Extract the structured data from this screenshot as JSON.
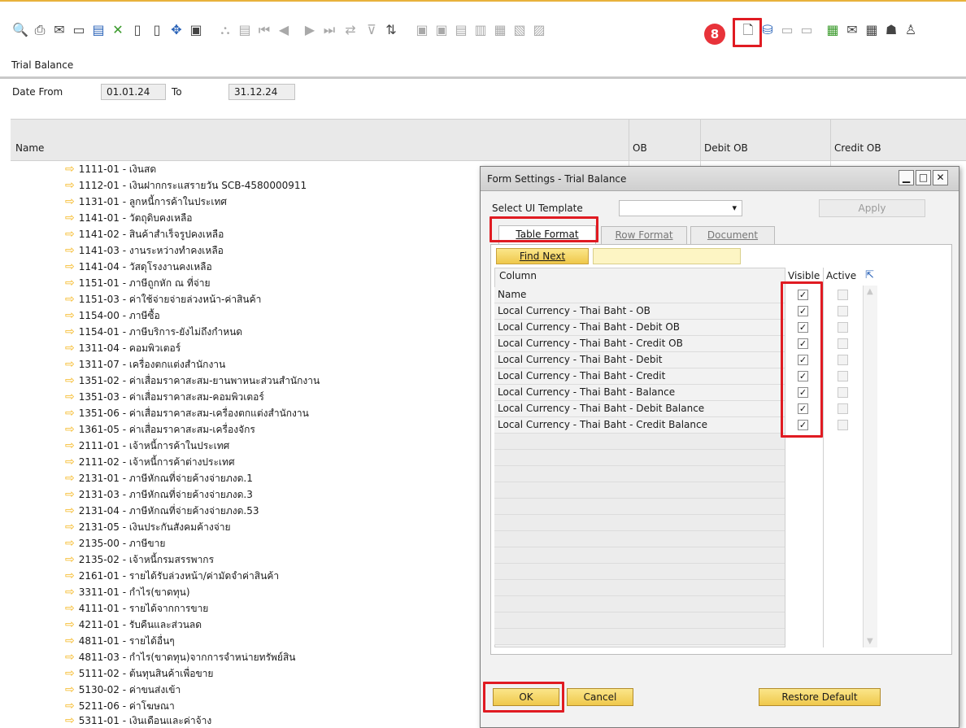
{
  "toolbar": {
    "badge": "8",
    "icons": [
      "print-preview-icon",
      "print-icon",
      "email-icon",
      "export-icon",
      "save-icon",
      "excel-icon",
      "word-icon",
      "pdf-icon",
      "refresh-icon",
      "form-lock-icon",
      "find-icon",
      "drill-icon",
      "first-record-icon",
      "previous-record-icon",
      "next-record-icon",
      "last-record-icon",
      "swap-icon",
      "filter-icon",
      "sort-icon",
      "copy-from-icon",
      "copy-to-icon",
      "base-document-icon",
      "target-document-icon",
      "gross-profit-icon",
      "journal-icon",
      "report-icon",
      "form-settings-icon",
      "query-settings-icon",
      "messages-icon",
      "alerts-icon",
      "calendar-icon",
      "close-mail-icon",
      "calculator-icon",
      "tree-icon",
      "user-icon"
    ]
  },
  "form": {
    "title": "Trial Balance",
    "date_from_label": "Date From",
    "date_from": "01.01.24",
    "to_label": "To",
    "date_to": "31.12.24"
  },
  "grid": {
    "headers": {
      "name": "Name",
      "ob": "OB",
      "debit_ob": "Debit OB",
      "credit_ob": "Credit OB"
    },
    "accounts": [
      "1111-01 - เงินสด",
      "1112-01 - เงินฝากกระแสรายวัน SCB-4580000911",
      "1131-01 - ลูกหนี้การค้าในประเทศ",
      "1141-01 - วัตถุดิบคงเหลือ",
      "1141-02 - สินค้าสำเร็จรูปคงเหลือ",
      "1141-03 - งานระหว่างทำคงเหลือ",
      "1141-04 - วัสดุโรงงานคงเหลือ",
      "1151-01 - ภาษีถูกหัก ณ ที่จ่าย",
      "1151-03 - ค่าใช้จ่ายจ่ายล่วงหน้า-ค่าสินค้า",
      "1154-00 - ภาษีซื้อ",
      "1154-01 - ภาษีบริการ-ยังไม่ถึงกำหนด",
      "1311-04 - คอมพิวเตอร์",
      "1311-07 - เครื่องตกแต่งสำนักงาน",
      "1351-02 - ค่าเสื่อมราคาสะสม-ยานพาหนะส่วนสำนักงาน",
      "1351-03 - ค่าเสื่อมราคาสะสม-คอมพิวเตอร์",
      "1351-06 - ค่าเสื่อมราคาสะสม-เครื่องตกแต่งสำนักงาน",
      "1361-05 - ค่าเสื่อมราคาสะสม-เครื่องจักร",
      "2111-01 - เจ้าหนี้การค้าในประเทศ",
      "2111-02 - เจ้าหนี้การค้าต่างประเทศ",
      "2131-01 - ภาษีหักณที่จ่ายค้างจ่ายภงด.1",
      "2131-03 - ภาษีหักณที่จ่ายค้างจ่ายภงด.3",
      "2131-04 - ภาษีหักณที่จ่ายค้างจ่ายภงด.53",
      "2131-05 - เงินประกันสังคมค้างจ่าย",
      "2135-00 - ภาษีขาย",
      "2135-02 - เจ้าหนี้กรมสรรพากร",
      "2161-01 - รายได้รับล่วงหน้า/ค่ามัดจำค่าสินค้า",
      "3311-01 - กำไร(ขาดทุน)",
      "4111-01 - รายได้จากการขาย",
      "4211-01 - รับคืนและส่วนลด",
      "4811-01 - รายได้อื่นๆ",
      "4811-03 - กำไร(ขาดทุน)จากการจำหน่ายทรัพย์สิน",
      "5111-02 - ต้นทุนสินค้าเพื่อขาย",
      "5130-02 - ค่าขนส่งเข้า",
      "5211-06 - ค่าโฆษณา",
      "5311-01 - เงินเดือนและค่าจ้าง"
    ]
  },
  "dialog": {
    "title": "Form Settings - Trial Balance",
    "select_template_label": "Select UI Template",
    "select_template_value": "",
    "apply_label": "Apply",
    "tabs": [
      "Table Format",
      "Row Format",
      "Document"
    ],
    "find_next_label": "Find Next",
    "find_value": "",
    "col_header": "Column",
    "visible_header": "Visible",
    "active_header": "Active",
    "columns": [
      {
        "name": "Name",
        "visible": true,
        "active": false
      },
      {
        "name": "Local Currency - Thai Baht - OB",
        "visible": true,
        "active": false
      },
      {
        "name": "Local Currency - Thai Baht - Debit OB",
        "visible": true,
        "active": false
      },
      {
        "name": "Local Currency - Thai Baht - Credit OB",
        "visible": true,
        "active": false
      },
      {
        "name": "Local Currency - Thai Baht - Debit",
        "visible": true,
        "active": false
      },
      {
        "name": "Local Currency - Thai Baht - Credit",
        "visible": true,
        "active": false
      },
      {
        "name": "Local Currency - Thai Baht - Balance",
        "visible": true,
        "active": false
      },
      {
        "name": "Local Currency - Thai Baht - Debit Balance",
        "visible": true,
        "active": false
      },
      {
        "name": "Local Currency - Thai Baht - Credit Balance",
        "visible": true,
        "active": false
      }
    ],
    "ok_label": "OK",
    "cancel_label": "Cancel",
    "restore_label": "Restore Default"
  }
}
